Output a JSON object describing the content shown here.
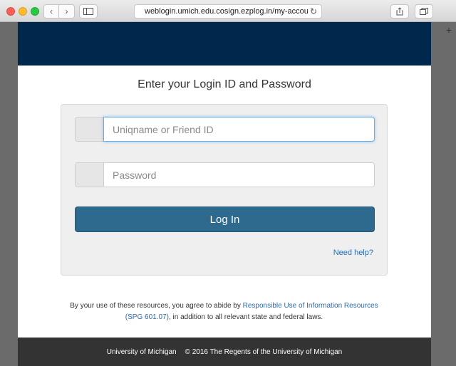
{
  "browser": {
    "url": "weblogin.umich.edu.cosign.ezplog.in/my-accou",
    "icons": {
      "back": "chevron-left-icon",
      "forward": "chevron-right-icon",
      "sidebar": "sidebar-icon",
      "reload": "reload-icon",
      "share": "share-icon",
      "tabs": "tabs-icon",
      "new_tab": "plus-icon"
    }
  },
  "colors": {
    "header_band": "#00274c",
    "login_button": "#2e6a8e",
    "link": "#2a6bb0",
    "footer": "#333333"
  },
  "login": {
    "title": "Enter your Login ID and Password",
    "username_placeholder": "Uniqname or Friend ID",
    "password_placeholder": "Password",
    "login_label": "Log In",
    "help_label": "Need help?"
  },
  "terms": {
    "prefix": "By your use of these resources, you agree to abide by ",
    "link_text": "Responsible Use of Information Resources (SPG 601.07)",
    "suffix": ", in addition to all relevant state and federal laws."
  },
  "footer": {
    "university": "University of Michigan",
    "copyright": "© 2016 The Regents of the University of Michigan"
  }
}
